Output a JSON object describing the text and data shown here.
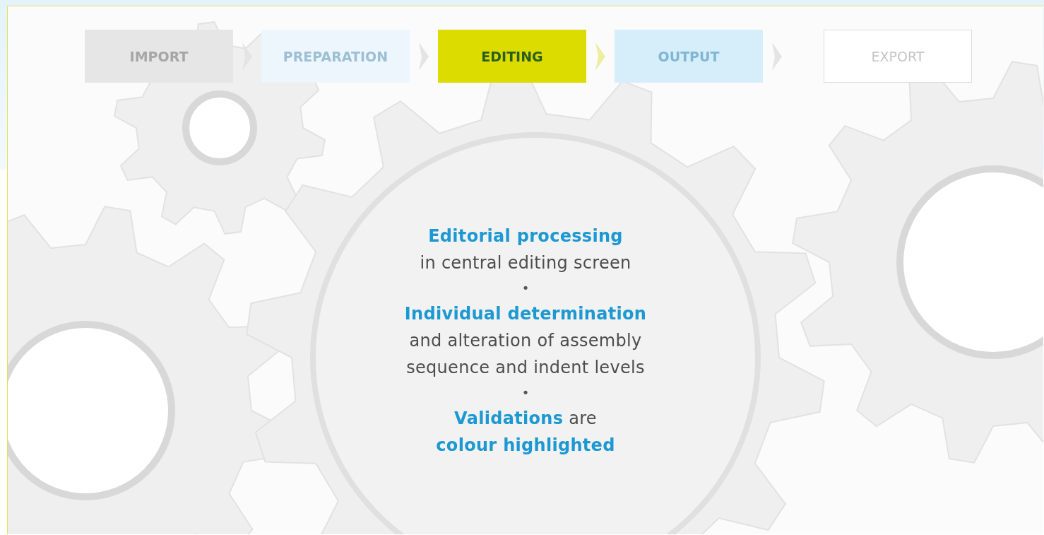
{
  "steps": [
    {
      "label": "IMPORT",
      "kind": "filled",
      "color": "#e6e6e6",
      "selected": false
    },
    {
      "label": "PREPARATION",
      "kind": "filled",
      "color": "#edf6fc",
      "selected": false
    },
    {
      "label": "EDITING",
      "kind": "filled",
      "color": "#dcdc00",
      "selected": true
    },
    {
      "label": "OUTPUT",
      "kind": "filled",
      "color": "#d6eef9",
      "selected": false
    },
    {
      "label": "EXPORT",
      "kind": "outlined",
      "color": "#ffffff",
      "selected": false
    }
  ],
  "content": [
    {
      "kind": "paragraph",
      "text": "**Editorial processing**\nin central editing screen"
    },
    {
      "kind": "separator",
      "text": "•"
    },
    {
      "kind": "paragraph",
      "text": "**Individual determination**\nand alteration of assembly\nsequence and indent levels"
    },
    {
      "kind": "separator",
      "text": "•"
    },
    {
      "kind": "paragraph",
      "text": "**Validations** are\n**colour highlighted**"
    }
  ]
}
